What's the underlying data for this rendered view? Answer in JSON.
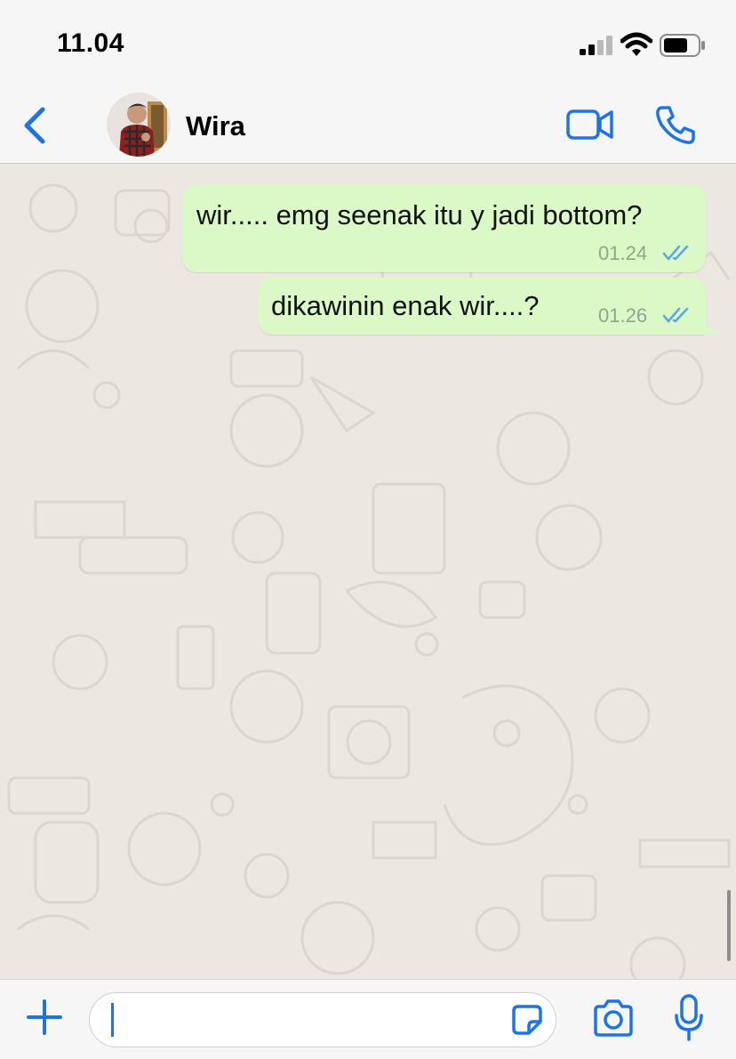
{
  "status_bar": {
    "time": "11.04"
  },
  "header": {
    "contact_name": "Wira"
  },
  "messages": [
    {
      "text": "wir..... emg seenak itu y jadi bottom?",
      "time": "01.24",
      "status": "read"
    },
    {
      "text": "dikawinin enak wir....?",
      "time": "01.26",
      "status": "read"
    }
  ],
  "composer": {
    "value": "",
    "placeholder": ""
  },
  "icons": {
    "back": "chevron-left-icon",
    "video": "video-camera-icon",
    "call": "phone-icon",
    "attach": "plus-icon",
    "sticker": "sticker-icon",
    "camera": "camera-icon",
    "mic": "microphone-icon"
  },
  "colors": {
    "accent": "#1e73e8",
    "outgoing_bubble": "#dbf8c7",
    "chat_background": "#ece8e1",
    "read_ticks": "#5aa6e6"
  }
}
